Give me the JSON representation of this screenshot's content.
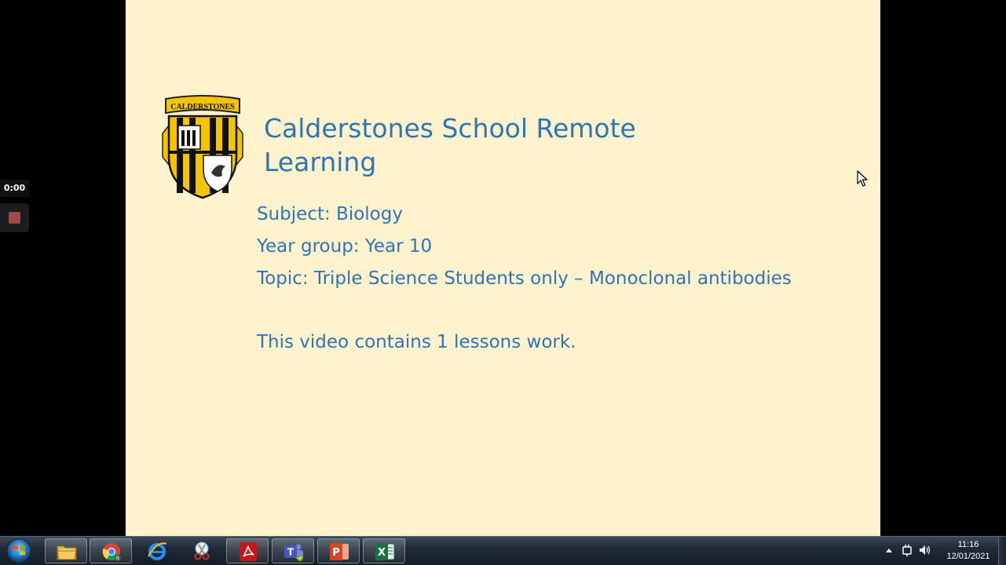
{
  "slide": {
    "title": "Calderstones School Remote Learning",
    "logo_text": "CALDERSTONES",
    "subject": "Subject: Biology",
    "year_group": "Year group: Year 10",
    "topic": "Topic:  Triple Science Students only – Monoclonal antibodies",
    "note": "This video contains 1 lessons work."
  },
  "recorder": {
    "timer": "0:00"
  },
  "taskbar": {
    "apps": [
      {
        "name": "start",
        "icon": "windows-orb-icon"
      },
      {
        "name": "Windows Explorer",
        "icon": "folder-icon"
      },
      {
        "name": "Google Chrome",
        "icon": "chrome-icon"
      },
      {
        "name": "Internet Explorer",
        "icon": "ie-icon"
      },
      {
        "name": "Snipping Tool",
        "icon": "scissors-icon"
      },
      {
        "name": "Adobe Acrobat",
        "icon": "acrobat-icon"
      },
      {
        "name": "Microsoft Teams",
        "icon": "teams-icon"
      },
      {
        "name": "PowerPoint",
        "icon": "powerpoint-icon"
      },
      {
        "name": "Excel",
        "icon": "excel-icon"
      }
    ],
    "clock": {
      "time": "11:16",
      "date": "12/01/2021"
    }
  },
  "colors": {
    "slide_background": "#fff2cc",
    "slide_text": "#2e75b6"
  }
}
